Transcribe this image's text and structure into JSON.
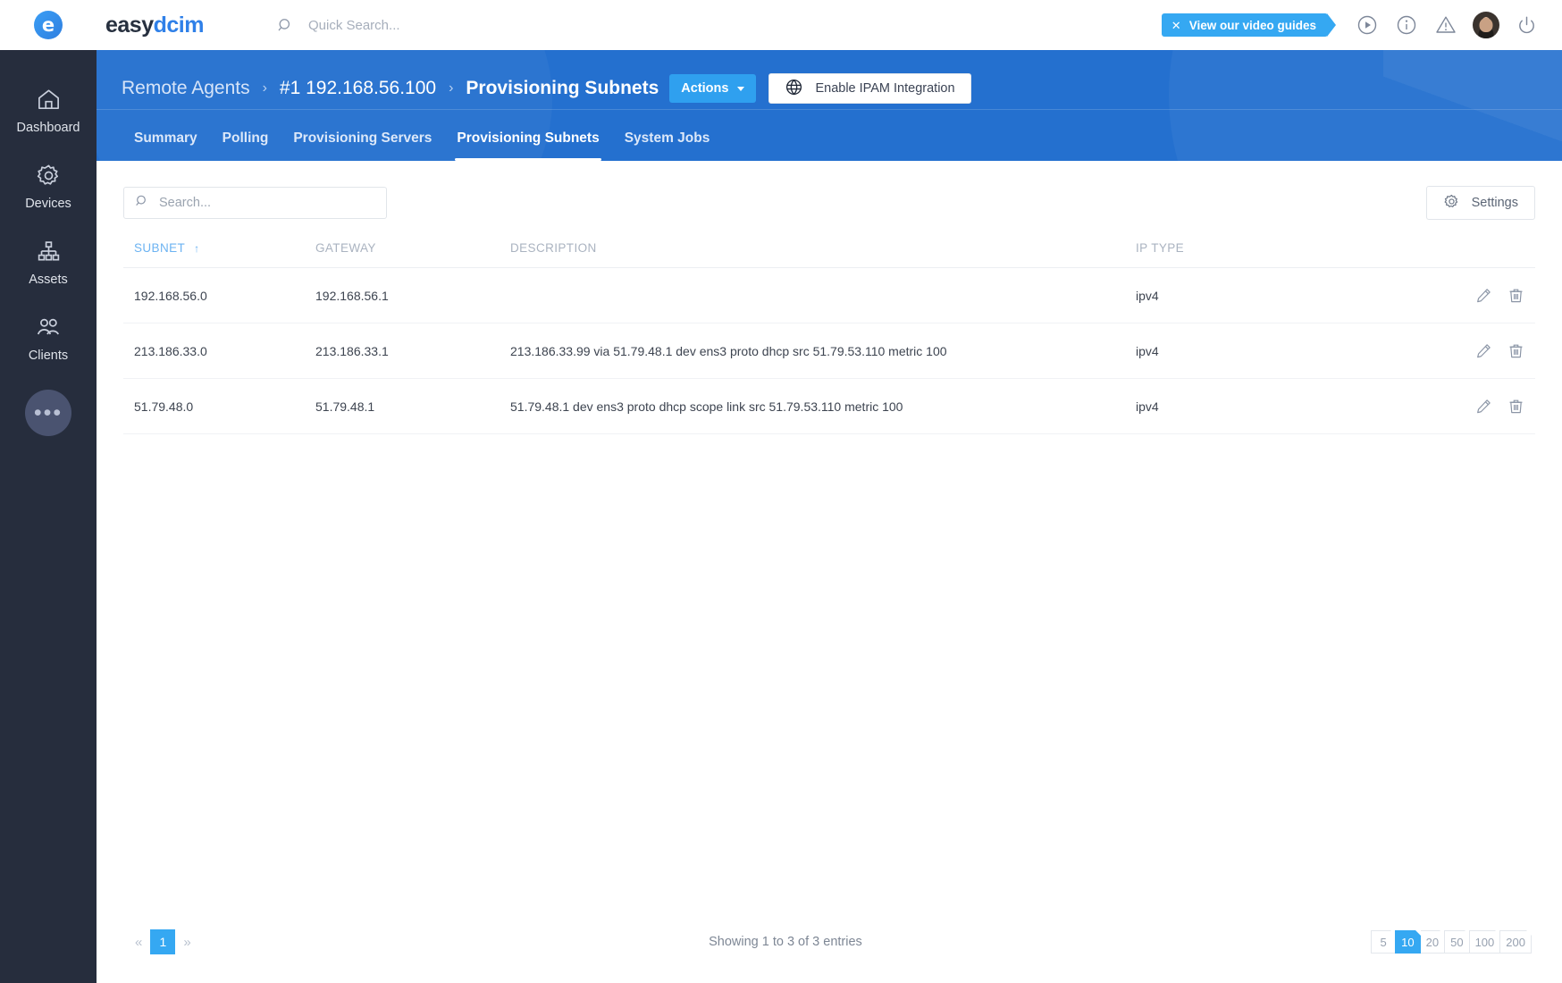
{
  "topbar": {
    "logo": {
      "part1": "easy",
      "part2": "dcim",
      "mark": "e",
      "icon_name": "easydcim-logo"
    },
    "quick_search": {
      "placeholder": "Quick Search...",
      "value": "",
      "icon": "search-icon"
    },
    "video_guides": {
      "label": "View our video guides",
      "close": "✕"
    },
    "icons": [
      "play-circle-icon",
      "info-circle-icon",
      "warning-triangle-icon",
      "avatar",
      "power-icon"
    ]
  },
  "sidebar": {
    "items": [
      {
        "label": "Dashboard",
        "icon": "home-icon"
      },
      {
        "label": "Devices",
        "icon": "gear-icon"
      },
      {
        "label": "Assets",
        "icon": "sitemap-icon"
      },
      {
        "label": "Clients",
        "icon": "users-icon"
      }
    ],
    "more": {
      "label": "•••",
      "icon": "ellipsis-icon"
    }
  },
  "header": {
    "breadcrumb": [
      {
        "label": "Remote Agents",
        "active": false
      },
      {
        "label": "#1 192.168.56.100",
        "active": false
      },
      {
        "label": "Provisioning Subnets",
        "active": true
      }
    ],
    "separator": "›",
    "actions_button": {
      "label": "Actions",
      "icon": "chevron-down-icon"
    },
    "ipam_button": {
      "label": "Enable IPAM Integration",
      "icon": "globe-icon"
    },
    "tabs": [
      {
        "label": "Summary",
        "active": false
      },
      {
        "label": "Polling",
        "active": false
      },
      {
        "label": "Provisioning Servers",
        "active": false
      },
      {
        "label": "Provisioning Subnets",
        "active": true
      },
      {
        "label": "System Jobs",
        "active": false
      }
    ]
  },
  "toolbar": {
    "search": {
      "placeholder": "Search...",
      "value": "",
      "icon": "search-icon"
    },
    "settings_button": {
      "label": "Settings",
      "icon": "gear-icon"
    }
  },
  "table": {
    "columns": [
      {
        "label": "SUBNET",
        "sorted": true,
        "sort_arrow": "↑"
      },
      {
        "label": "GATEWAY",
        "sorted": false
      },
      {
        "label": "DESCRIPTION",
        "sorted": false
      },
      {
        "label": "IP TYPE",
        "sorted": false
      },
      {
        "label": "",
        "sorted": false
      }
    ],
    "rows": [
      {
        "subnet": "192.168.56.0",
        "gateway": "192.168.56.1",
        "description": "",
        "ip_type": "ipv4",
        "actions": [
          "edit-icon",
          "delete-icon"
        ]
      },
      {
        "subnet": "213.186.33.0",
        "gateway": "213.186.33.1",
        "description": "213.186.33.99 via 51.79.48.1 dev ens3 proto dhcp src 51.79.53.110 metric 100",
        "ip_type": "ipv4",
        "actions": [
          "edit-icon",
          "delete-icon"
        ]
      },
      {
        "subnet": "51.79.48.0",
        "gateway": "51.79.48.1",
        "description": "51.79.48.1 dev ens3 proto dhcp scope link src 51.79.53.110 metric 100",
        "ip_type": "ipv4",
        "actions": [
          "edit-icon",
          "delete-icon"
        ]
      }
    ]
  },
  "footer": {
    "prev": "«",
    "next": "»",
    "current_page": "1",
    "showing": "Showing 1 to 3 of 3 entries",
    "page_sizes": [
      "5",
      "10",
      "20",
      "50",
      "100",
      "200"
    ],
    "active_page_size": "10"
  },
  "colors": {
    "header_blue": "#2470cf",
    "accent_blue": "#35a8f2",
    "sidebar_dark": "#262d3d",
    "text_dark": "#3d4450",
    "muted": "#aab3c0"
  }
}
